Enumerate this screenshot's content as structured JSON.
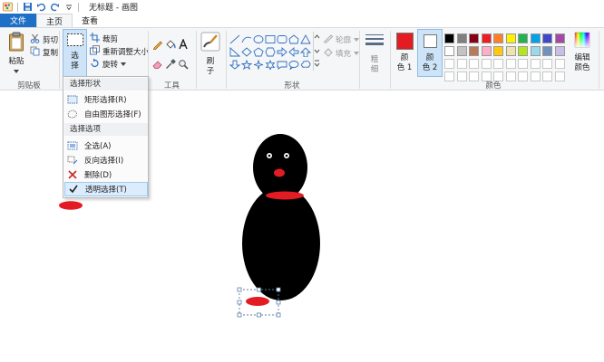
{
  "window": {
    "title": "无标题 - 画图"
  },
  "tabs": [
    {
      "label": "文件"
    },
    {
      "label": "主页"
    },
    {
      "label": "查看"
    }
  ],
  "ribbon": {
    "clipboard": {
      "paste": "粘贴",
      "cut": "剪切",
      "copy": "复制",
      "group": "剪贴板"
    },
    "image": {
      "select_line1": "选",
      "select_line2": "择",
      "crop": "裁剪",
      "resize": "重新调整大小",
      "rotate": "旋转"
    },
    "tools": {
      "group": "工具"
    },
    "brushes": {
      "line1": "刷",
      "line2": "子"
    },
    "shapes": {
      "outline": "轮廓",
      "fill": "填充",
      "group": "形状"
    },
    "size": {
      "line1": "粗",
      "line2": "细"
    },
    "colors": {
      "color1_line1": "颜",
      "color1_line2": "色 1",
      "color2_line1": "颜",
      "color2_line2": "色 2",
      "edit_line1": "编辑",
      "edit_line2": "颜色",
      "group": "颜色",
      "color1": "#e31b23",
      "color2": "#ffffff",
      "palette_row1": [
        "#000000",
        "#7f7f7f",
        "#880015",
        "#ed1c24",
        "#ff7f27",
        "#fff200",
        "#22b14c",
        "#00a2e8",
        "#3f48cc",
        "#a349a4"
      ],
      "palette_row2": [
        "#ffffff",
        "#c3c3c3",
        "#b97a57",
        "#ffaec9",
        "#ffc90e",
        "#efe4b0",
        "#b5e61d",
        "#99d9ea",
        "#7092be",
        "#c8bfe7"
      ]
    }
  },
  "select_menu": {
    "header_shape": "选择形状",
    "rect_select": "矩形选择(R)",
    "freeform_select": "自由图形选择(F)",
    "header_options": "选择选项",
    "select_all": "全选(A)",
    "invert_select": "反向选择(I)",
    "delete": "删除(D)",
    "transparent_select": "透明选择(T)"
  },
  "canvas": {
    "figure_color": "#000000",
    "accent_color": "#e31b23"
  }
}
